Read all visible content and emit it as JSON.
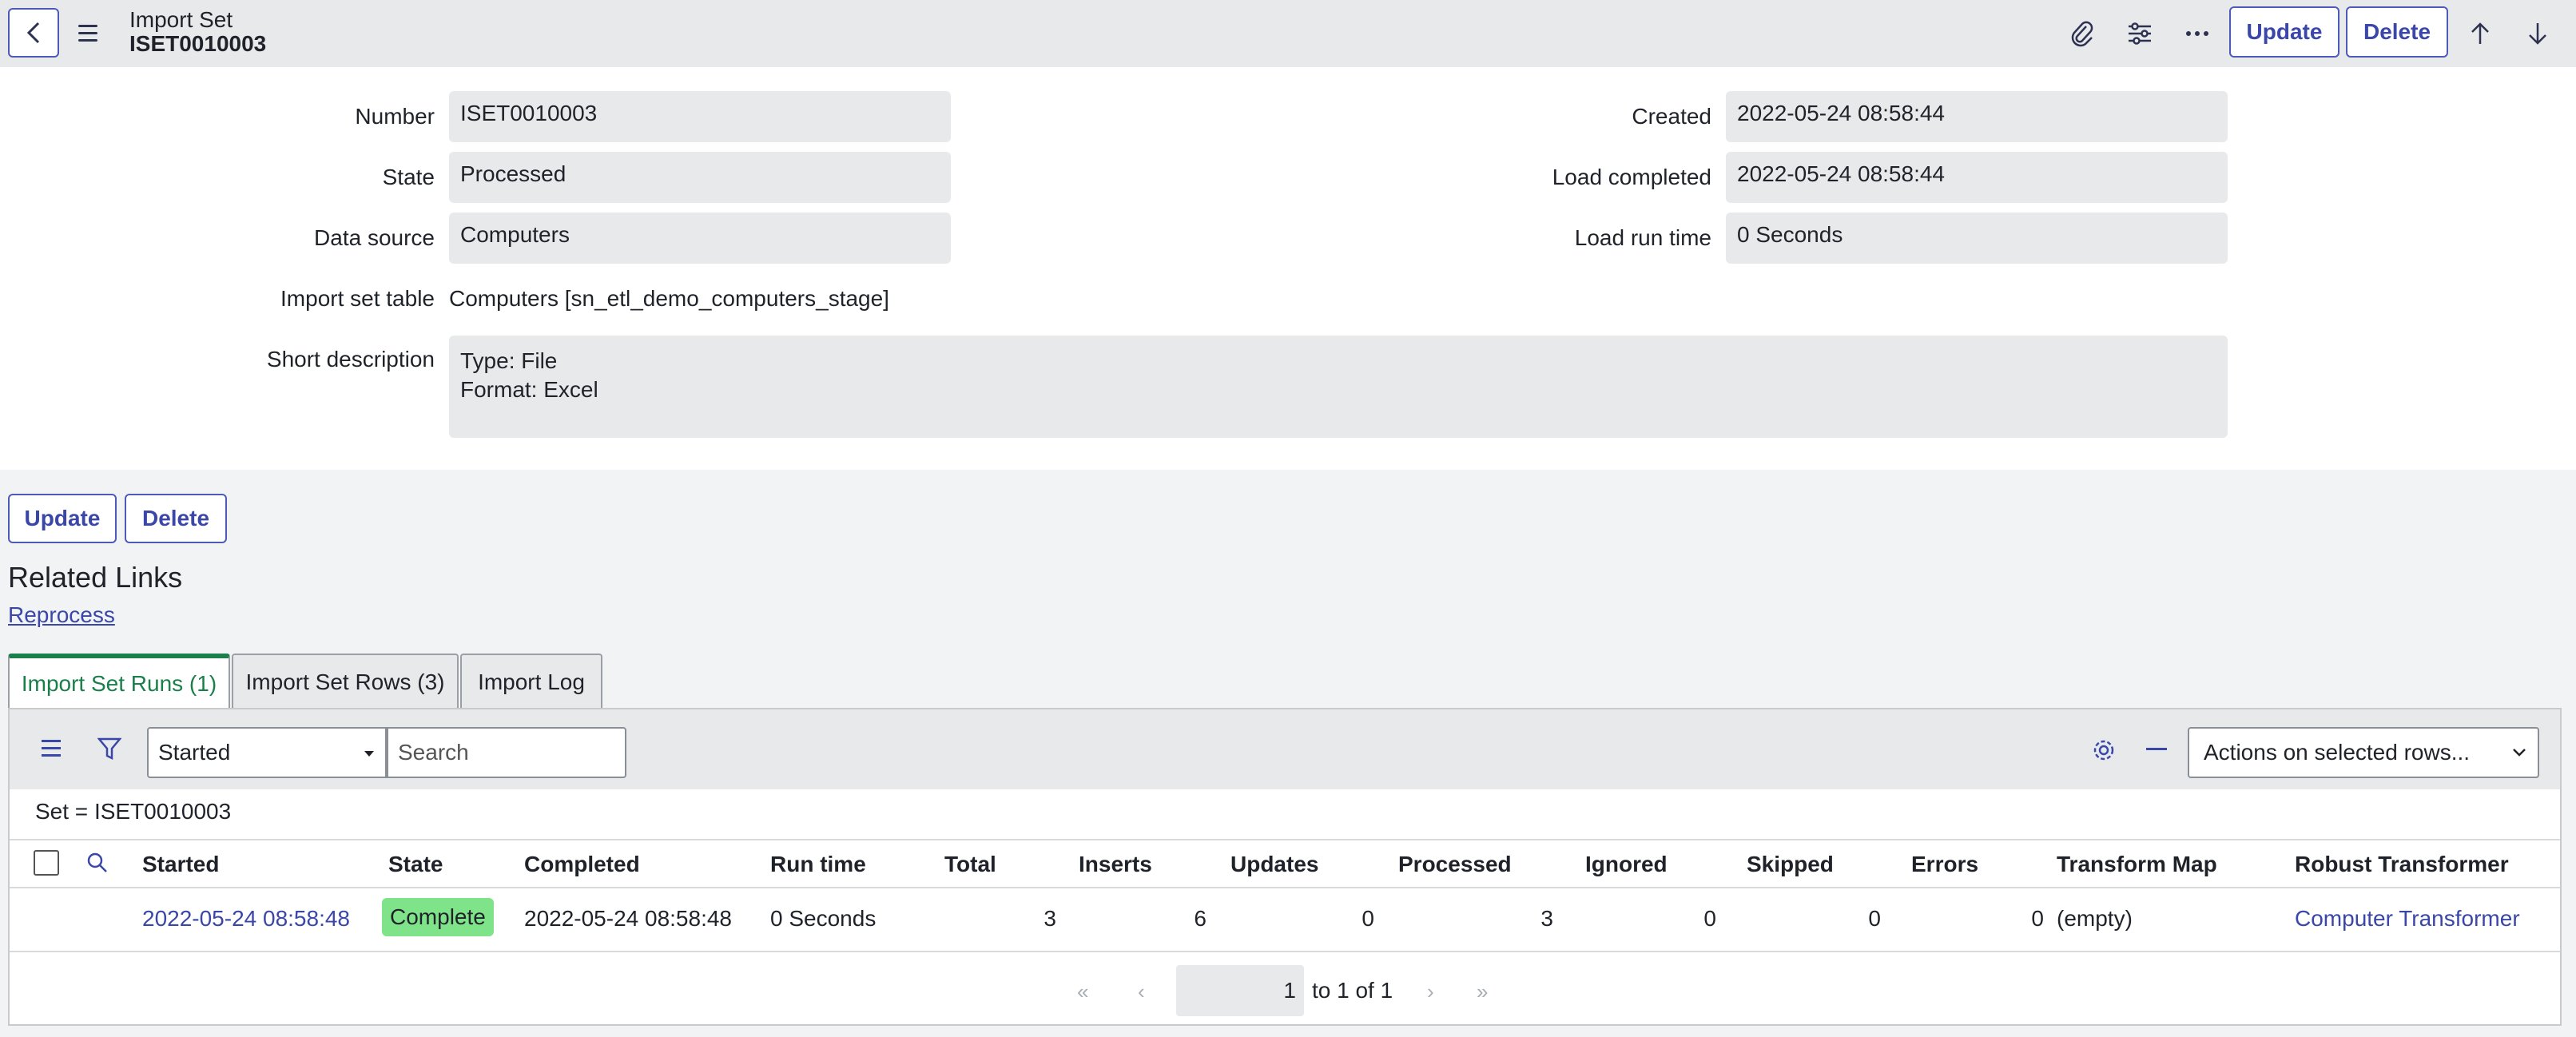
{
  "header": {
    "title_line1": "Import Set",
    "title_line2": "ISET0010003",
    "update_label": "Update",
    "delete_label": "Delete"
  },
  "form": {
    "number_label": "Number",
    "number_value": "ISET0010003",
    "state_label": "State",
    "state_value": "Processed",
    "data_source_label": "Data source",
    "data_source_value": "Computers",
    "import_set_table_label": "Import set table",
    "import_set_table_value": "Computers [sn_etl_demo_computers_stage]",
    "short_description_label": "Short description",
    "short_description_line1": "Type: File",
    "short_description_line2": "Format: Excel",
    "created_label": "Created",
    "created_value": "2022-05-24 08:58:44",
    "load_completed_label": "Load completed",
    "load_completed_value": "2022-05-24 08:58:44",
    "load_run_time_label": "Load run time",
    "load_run_time_value": "0 Seconds"
  },
  "bottom_buttons": {
    "update_label": "Update",
    "delete_label": "Delete"
  },
  "related": {
    "title": "Related Links",
    "reprocess_label": "Reprocess"
  },
  "tabs": [
    {
      "label": "Import Set Runs (1)"
    },
    {
      "label": "Import Set Rows (3)"
    },
    {
      "label": "Import Log"
    }
  ],
  "list": {
    "select_value": "Started",
    "search_placeholder": "Search",
    "actions_value": "Actions on selected rows...",
    "filter_text": "Set = ISET0010003",
    "columns": [
      "Started",
      "State",
      "Completed",
      "Run time",
      "Total",
      "Inserts",
      "Updates",
      "Processed",
      "Ignored",
      "Skipped",
      "Errors",
      "Transform Map",
      "Robust Transformer"
    ],
    "row": {
      "started": "2022-05-24 08:58:48",
      "state": "Complete",
      "completed": "2022-05-24 08:58:48",
      "run_time": "0 Seconds",
      "total": "3",
      "inserts": "6",
      "updates": "0",
      "processed": "3",
      "ignored": "0",
      "skipped": "0",
      "errors": "0",
      "transform_map": "(empty)",
      "robust_transformer": "Computer Transformer"
    },
    "pager": {
      "page": "1",
      "range_text": "to 1 of 1"
    }
  },
  "colors": {
    "accent": "#3a47a8",
    "tab_active": "#1b7f4b",
    "complete_badge": "#7fe38a"
  }
}
